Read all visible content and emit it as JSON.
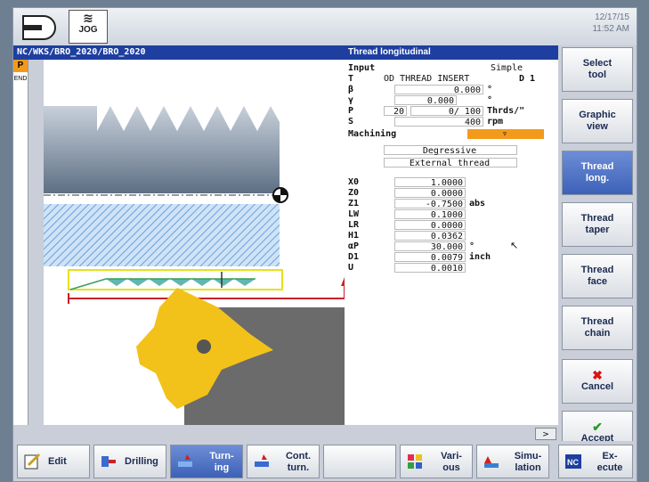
{
  "header": {
    "mode_label": "JOG",
    "date": "12/17/15",
    "time": "11:52 AM",
    "path": "NC/WKS/BRO_2020/BRO_2020",
    "screen_title": "Thread longitudinal"
  },
  "sidebar_left": {
    "tab_p": "P",
    "tab_end": "END"
  },
  "form": {
    "input_label": "Input",
    "input_value": "Simple",
    "rows": [
      {
        "label": "T",
        "value": "OD THREAD INSERT",
        "extra": "D 1"
      },
      {
        "label": "β",
        "value": "0.000",
        "unit": "°"
      },
      {
        "label": "γ",
        "value": "0.000",
        "unit": "°"
      },
      {
        "label": "P",
        "value1": "20",
        "value": "0/ 100",
        "unit": "Thrds/\""
      },
      {
        "label": "S",
        "value": "400",
        "unit": "rpm"
      }
    ],
    "machining_label": "Machining",
    "machining_value": "▿",
    "infeed": "Degressive",
    "thread_type": "External thread",
    "params": [
      {
        "label": "X0",
        "value": "1.0000",
        "unit": ""
      },
      {
        "label": "Z0",
        "value": "0.0000",
        "unit": ""
      },
      {
        "label": "Z1",
        "value": "-0.7500",
        "unit": "abs"
      },
      {
        "label": "LW",
        "value": "0.1000",
        "unit": ""
      },
      {
        "label": "LR",
        "value": "0.0000",
        "unit": ""
      },
      {
        "label": "H1",
        "value": "0.0362",
        "unit": ""
      },
      {
        "label": "αP",
        "value": "30.000",
        "unit": "°"
      },
      {
        "label": "D1",
        "value": "0.0079",
        "unit": "inch"
      },
      {
        "label": "U",
        "value": "0.0010",
        "unit": ""
      }
    ],
    "scroll_indicator": ">"
  },
  "vertical_softkeys": [
    {
      "label1": "Select",
      "label2": "tool",
      "active": false
    },
    {
      "label1": "Graphic",
      "label2": "view",
      "active": false
    },
    {
      "label1": "Thread",
      "label2": "long.",
      "active": true
    },
    {
      "label1": "Thread",
      "label2": "taper",
      "active": false
    },
    {
      "label1": "Thread",
      "label2": "face",
      "active": false
    },
    {
      "label1": "Thread",
      "label2": "chain",
      "active": false
    },
    {
      "label1": "✖",
      "label2": "Cancel",
      "active": false
    },
    {
      "label1": "✔",
      "label2": "Accept",
      "active": false
    }
  ],
  "horizontal_softkeys": [
    {
      "label1": "Edit",
      "label2": "",
      "active": false,
      "icon": "edit-icon"
    },
    {
      "label1": "Drilling",
      "label2": "",
      "active": false,
      "icon": "drilling-icon"
    },
    {
      "label1": "Turn-",
      "label2": "ing",
      "active": true,
      "icon": "turning-icon"
    },
    {
      "label1": "Cont.",
      "label2": "turn.",
      "active": false,
      "icon": "contour-turning-icon"
    },
    {
      "label1": "",
      "label2": "",
      "active": false,
      "icon": ""
    },
    {
      "label1": "Vari-",
      "label2": "ous",
      "active": false,
      "icon": "various-icon"
    },
    {
      "label1": "Simu-",
      "label2": "lation",
      "active": false,
      "icon": "simulation-icon"
    },
    {
      "label1": "Ex-",
      "label2": "ecute",
      "active": false,
      "icon": "nc-execute-icon"
    }
  ],
  "colors": {
    "title_blue": "#1e3fa0",
    "accent_orange": "#f39a1c",
    "active_key": "#3d61b7",
    "insert_yellow": "#f2c21a"
  }
}
